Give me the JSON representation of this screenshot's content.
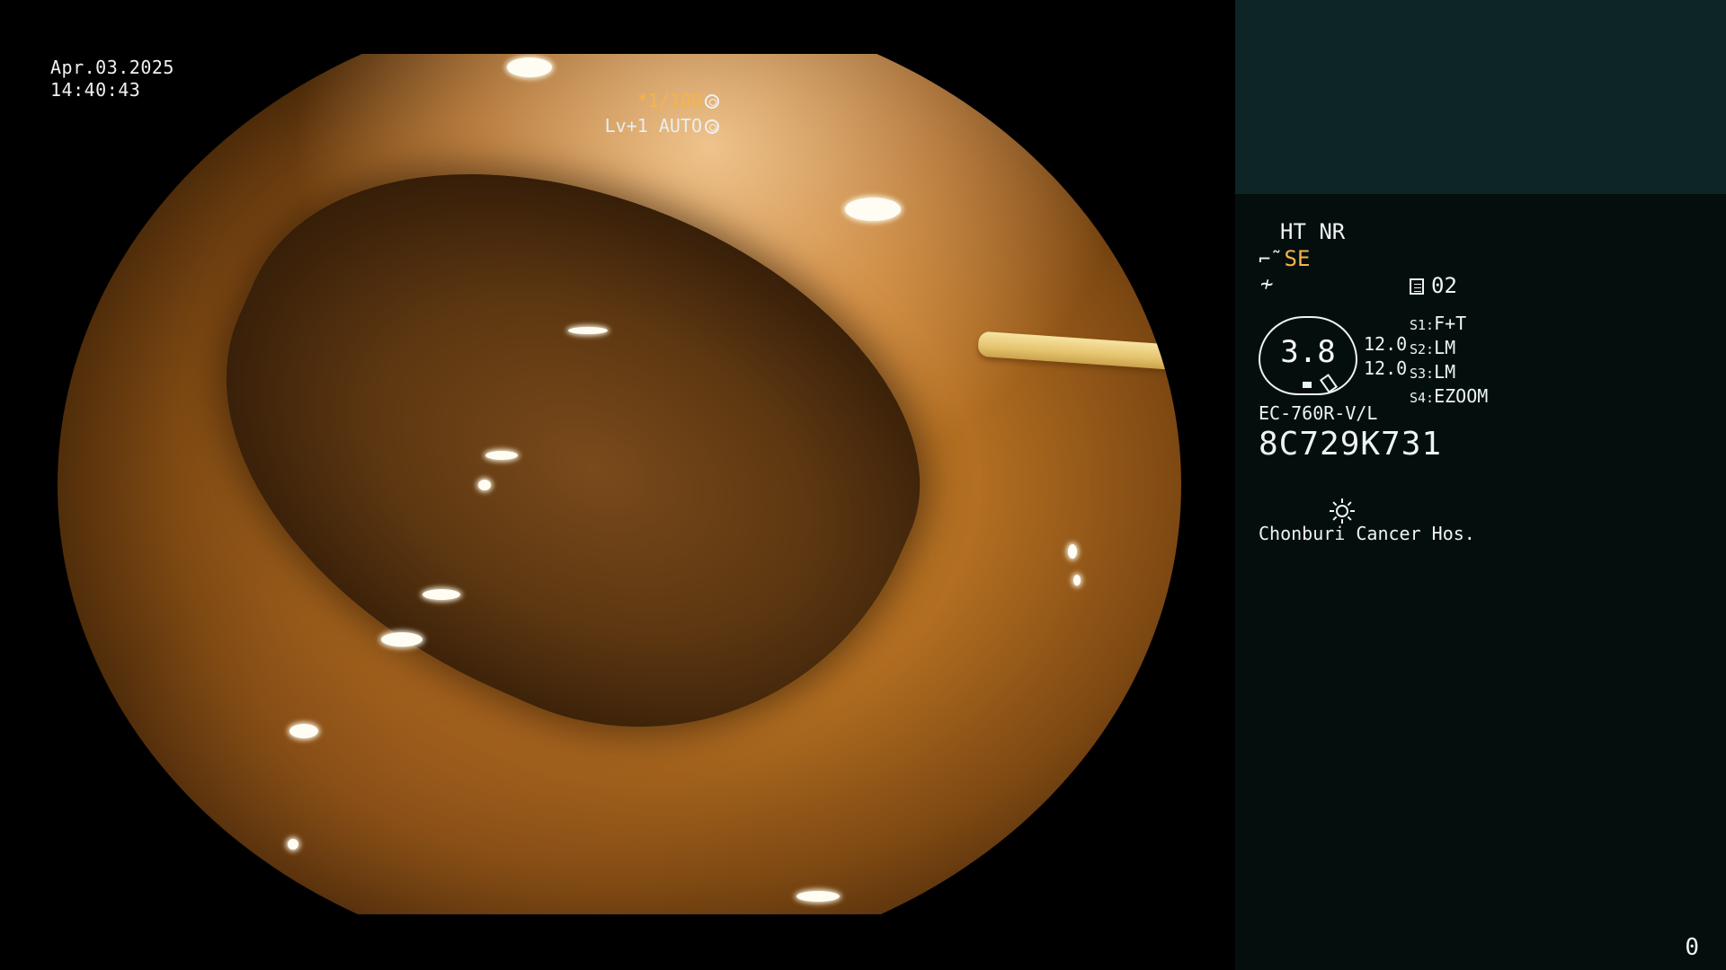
{
  "overlay": {
    "date": "Apr.03.2025",
    "time": "14:40:43",
    "shutter": "*1/100",
    "level": "Lv+1 AUTO"
  },
  "panel": {
    "mode": "HT NR",
    "enhancement": "SE",
    "memory": "02",
    "iris_value": "3.8",
    "value_a": "12.0",
    "value_b": "12.0",
    "switches": [
      {
        "key": "S1:",
        "value": "F+T"
      },
      {
        "key": "S2:",
        "value": "LM"
      },
      {
        "key": "S3:",
        "value": "LM"
      },
      {
        "key": "S4:",
        "value": "EZOOM"
      }
    ],
    "scope_model": "EC-760R-V/L",
    "serial": "8C729K731",
    "hospital": "Chonburi Cancer Hos.",
    "counter": "0"
  },
  "colors": {
    "panel_bg": "#040f0d",
    "thumbnail_bg": "#0d2524",
    "accent": "#f5b44a"
  },
  "icons": [
    "shutter-icon",
    "auto-level-icon",
    "scope-icon",
    "slash-icon",
    "document-icon",
    "light-icon"
  ]
}
